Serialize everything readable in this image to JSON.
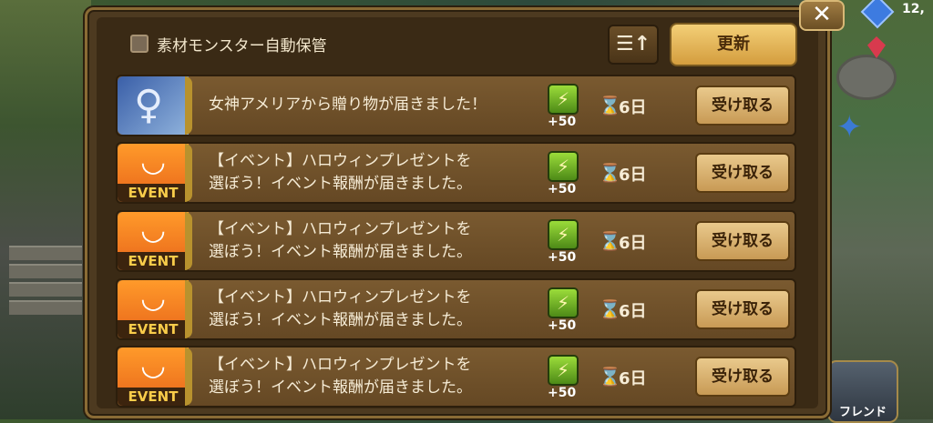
{
  "header": {
    "checkbox_label": "素材モンスター自動保管",
    "sort_label": "☰↑",
    "refresh_label": "更新",
    "close_label": "✕"
  },
  "hud": {
    "gem_count": "12,"
  },
  "friend_button": {
    "label": "フレンド"
  },
  "mail_rows": [
    {
      "icon": "goddess-icon",
      "message": "女神アメリアから贈り物が届きました！",
      "reward": "+50",
      "days": "6日",
      "claim": "受け取る"
    },
    {
      "icon": "event-icon",
      "event_badge": "EVENT",
      "message_line1": "【イベント】ハロウィンプレゼントを",
      "message_line2": "選ぼう！イベント報酬が届きました。",
      "reward": "+50",
      "days": "6日",
      "claim": "受け取る"
    },
    {
      "icon": "event-icon",
      "event_badge": "EVENT",
      "message_line1": "【イベント】ハロウィンプレゼントを",
      "message_line2": "選ぼう！イベント報酬が届きました。",
      "reward": "+50",
      "days": "6日",
      "claim": "受け取る"
    },
    {
      "icon": "event-icon",
      "event_badge": "EVENT",
      "message_line1": "【イベント】ハロウィンプレゼントを",
      "message_line2": "選ぼう！イベント報酬が届きました。",
      "reward": "+50",
      "days": "6日",
      "claim": "受け取る"
    },
    {
      "icon": "event-icon",
      "event_badge": "EVENT",
      "message_line1": "【イベント】ハロウィンプレゼントを",
      "message_line2": "選ぼう！イベント報酬が届きました。",
      "reward": "+50",
      "days": "6日",
      "claim": "受け取る"
    }
  ],
  "colors": {
    "panel_bg": "#3a2a15",
    "row_bg": "#7a5a30",
    "refresh_button": "#f3cf77",
    "claim_button": "#e9c98c",
    "event_orange": "#ff9a2a",
    "energy_green": "#9bdc3a"
  }
}
